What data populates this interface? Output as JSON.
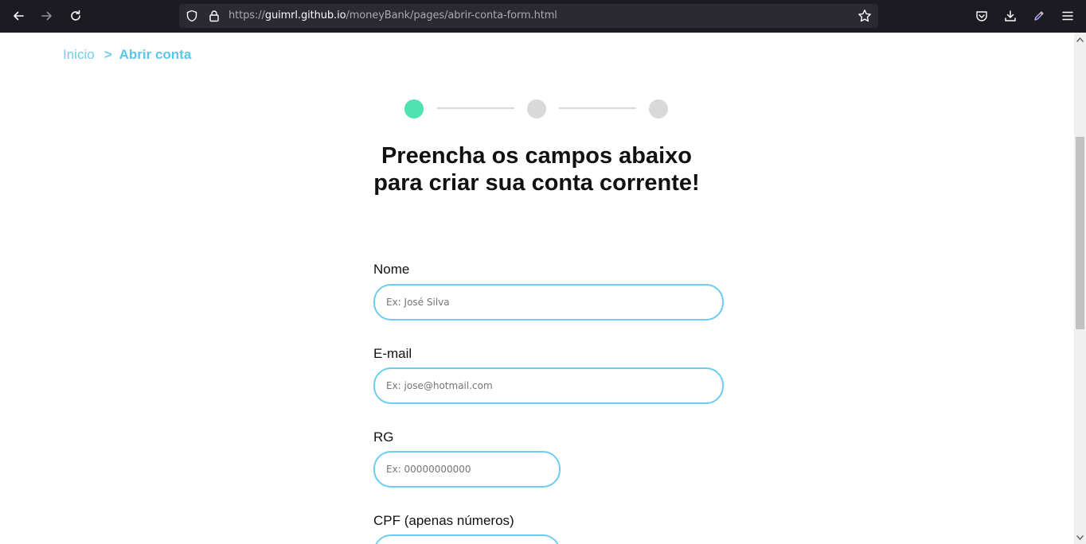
{
  "browser": {
    "url_prefix": "https://",
    "url_host": "guimrl.github.io",
    "url_path": "/moneyBank/pages/abrir-conta-form.html"
  },
  "breadcrumb": {
    "home": "Inicio",
    "separator": ">",
    "current": "Abrir conta"
  },
  "stepper": {
    "active_color": "#4ee3b0",
    "inactive_color": "#d9d9d9",
    "current_step": 1,
    "total_steps": 3
  },
  "title": "Preencha os campos abaixo para criar sua conta corrente!",
  "form": {
    "nome": {
      "label": "Nome",
      "placeholder": "Ex: José Silva"
    },
    "email": {
      "label": "E-mail",
      "placeholder": "Ex: jose@hotmail.com"
    },
    "rg": {
      "label": "RG",
      "placeholder": "Ex: 00000000000"
    },
    "cpf": {
      "label": "CPF (apenas números)",
      "placeholder": ""
    }
  },
  "colors": {
    "accent": "#6bcdf0",
    "breadcrumb": "#73cfef"
  }
}
